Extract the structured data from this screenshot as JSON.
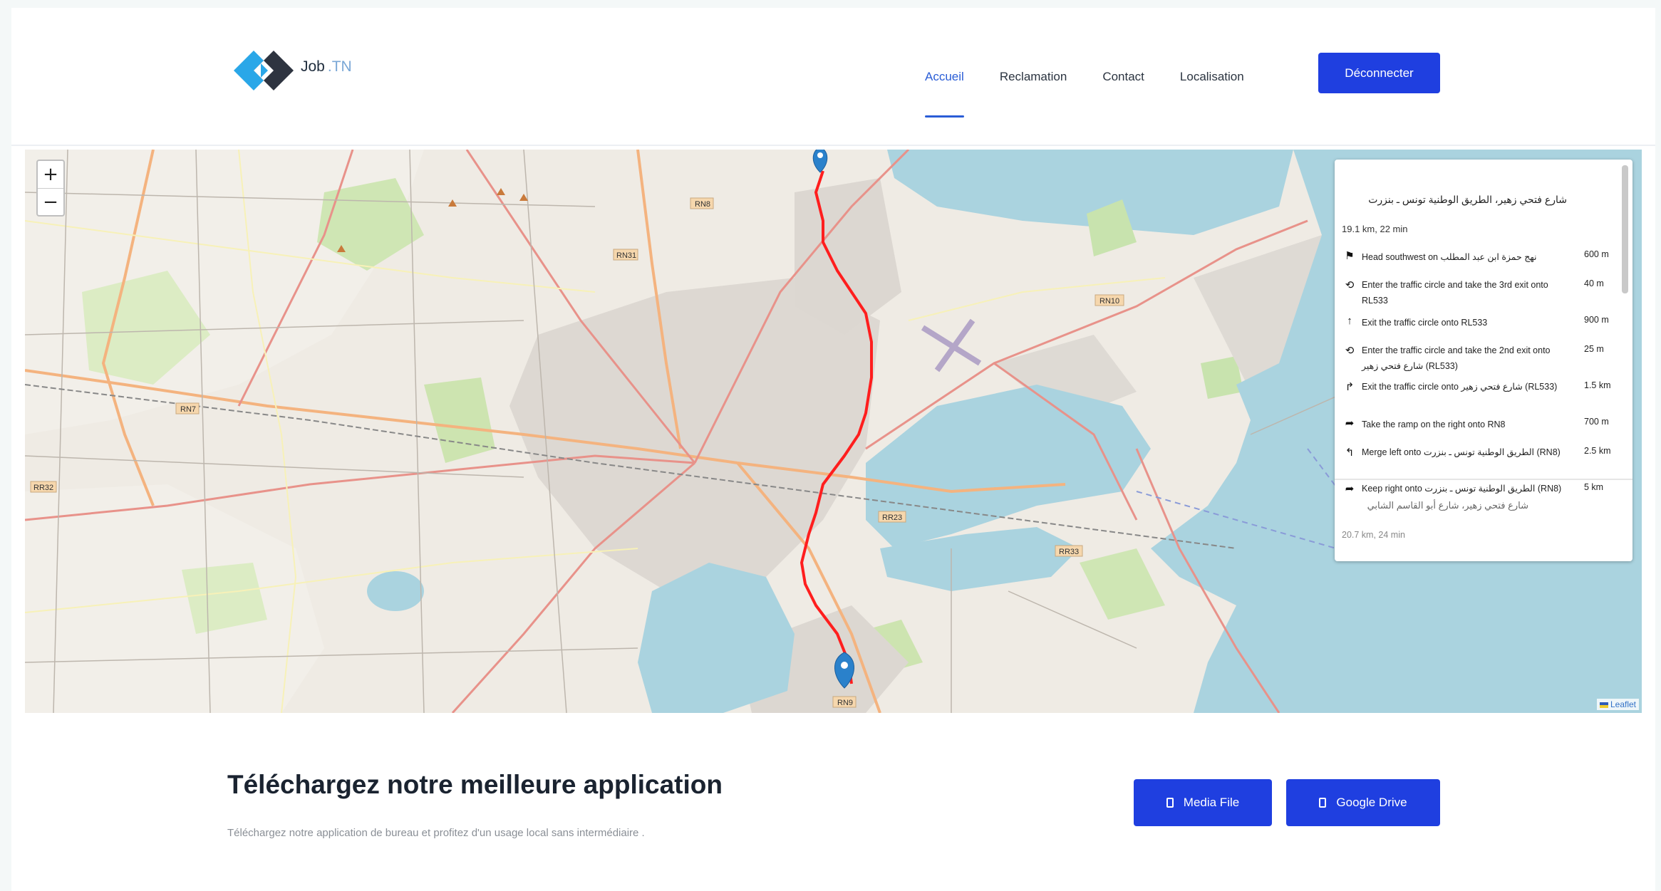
{
  "header": {
    "logo": {
      "name": "Job",
      "suffix": ".TN"
    },
    "nav": [
      {
        "label": "Accueil",
        "active": true
      },
      {
        "label": "Reclamation",
        "active": false
      },
      {
        "label": "Contact",
        "active": false
      },
      {
        "label": "Localisation",
        "active": false
      }
    ],
    "logout_label": "Déconnecter"
  },
  "map": {
    "zoom_in": "+",
    "zoom_out": "−",
    "road_labels": [
      "RN8",
      "RN31",
      "RN7",
      "RR32",
      "RN10",
      "RR23",
      "RR33",
      "RN9"
    ],
    "route_panel": {
      "title": "شارع فتحي زهير، الطريق الوطنية تونس ـ بنزرت",
      "summary": "19.1 km, 22 min",
      "instructions": [
        {
          "icon": "depart-icon",
          "glyph": "⚑",
          "text": "Head southwest on نهج حمزة ابن عبد المطلب",
          "distance": "600 m"
        },
        {
          "icon": "roundabout-icon",
          "glyph": "⟲",
          "text": "Enter the traffic circle and take the 3rd exit onto RL533",
          "distance": "40 m"
        },
        {
          "icon": "exit-roundabout-icon",
          "glyph": "↑",
          "text": "Exit the traffic circle onto RL533",
          "distance": "900 m"
        },
        {
          "icon": "roundabout-icon",
          "glyph": "⟲",
          "text": "Enter the traffic circle and take the 2nd exit onto شارع فتحي زهير (RL533)",
          "distance": "25 m"
        },
        {
          "icon": "turn-right-icon",
          "glyph": "↱",
          "text": "Exit the traffic circle onto شارع فتحي زهير (RL533)",
          "distance": "1.5 km"
        },
        {
          "icon": "ramp-right-icon",
          "glyph": "➦",
          "text": "Take the ramp on the right onto RN8",
          "distance": "700 m"
        },
        {
          "icon": "merge-left-icon",
          "glyph": "↰",
          "text": "Merge left onto الطريق الوطنية تونس ـ بنزرت (RN8)",
          "distance": "2.5 km"
        },
        {
          "icon": "keep-right-icon",
          "glyph": "➦",
          "text": "Keep right onto الطريق الوطنية تونس ـ بنزرت (RN8)",
          "distance": "5 km"
        }
      ],
      "alternative": {
        "title": "شارع فتحي زهير، شارع أبو القاسم الشابي",
        "summary": "20.7 km, 24 min"
      }
    },
    "attribution": "Leaflet",
    "colors": {
      "route": "#ff1e1e",
      "water": "#aad3df",
      "marker": "#2a81cb"
    }
  },
  "download": {
    "title": "Téléchargez notre meilleure application",
    "subtitle": "Téléchargez notre application de bureau et profitez d'un usage local sans intermédiaire .",
    "media_label": "Media File",
    "drive_label": "Google Drive"
  },
  "colors": {
    "primary": "#1f3fe0",
    "active_nav": "#2a5dd6"
  }
}
